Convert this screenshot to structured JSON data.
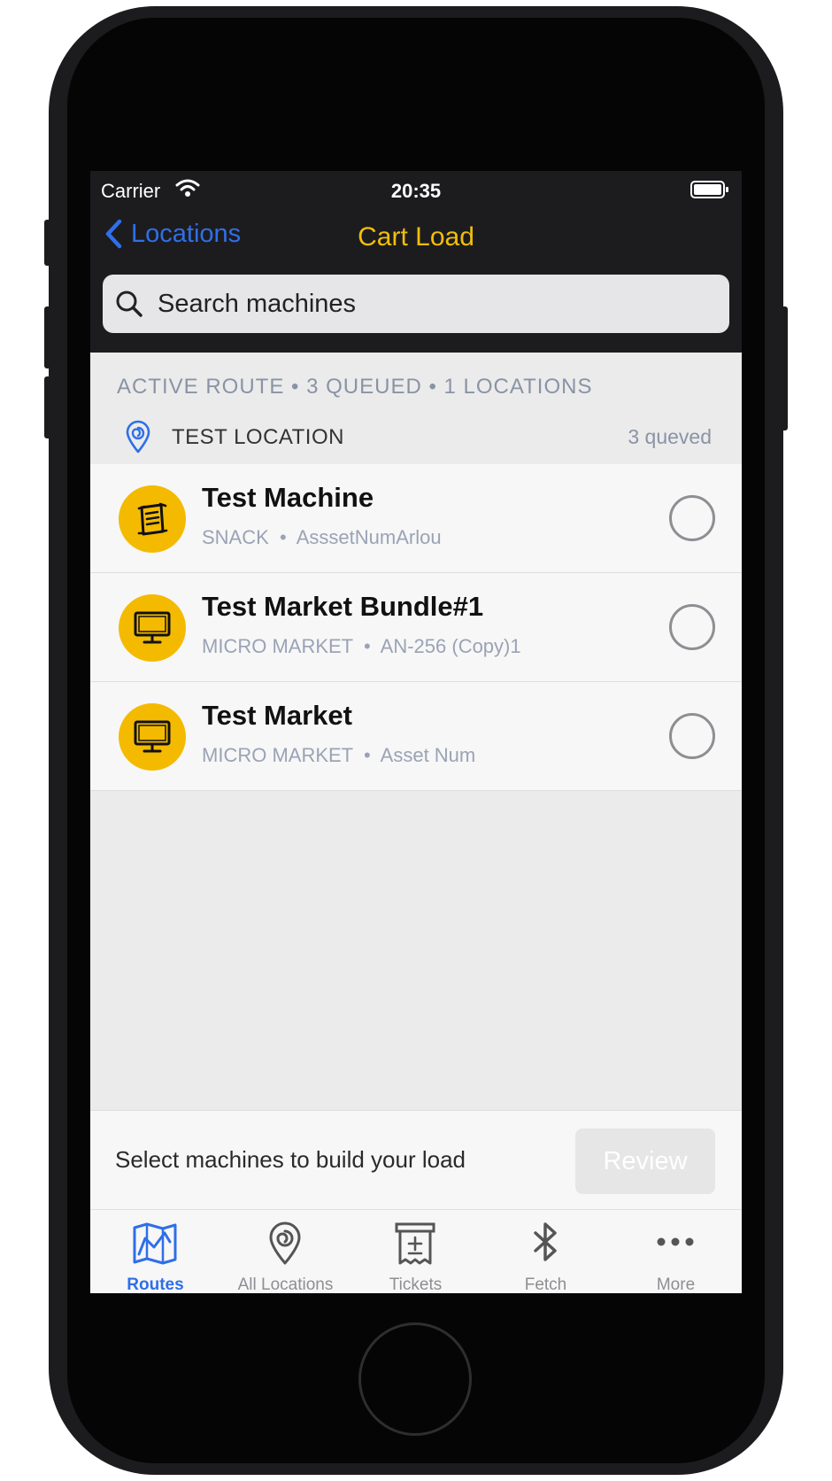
{
  "status_bar": {
    "carrier": "Carrier",
    "time": "20:35"
  },
  "nav": {
    "back_label": "Locations",
    "title": "Cart Load"
  },
  "search": {
    "placeholder": "Search machines"
  },
  "route": {
    "header": "ACTIVE ROUTE  •  3 QUEUED  •  1 LOCATIONS"
  },
  "location": {
    "name": "TEST LOCATION",
    "count": "3 queved"
  },
  "machines": [
    {
      "name": "Test Machine",
      "type": "SNACK",
      "asset": "AsssetNumArlou",
      "icon": "snack-icon"
    },
    {
      "name": "Test Market Bundle#1",
      "type": "MICRO MARKET",
      "asset": "AN-256 (Copy)1",
      "icon": "monitor-icon"
    },
    {
      "name": "Test Market",
      "type": "MICRO MARKET",
      "asset": "Asset Num",
      "icon": "monitor-icon"
    }
  ],
  "footer": {
    "hint": "Select machines to build your load",
    "review_label": "Review"
  },
  "tabs": [
    {
      "label": "Routes",
      "icon": "map-icon",
      "active": true
    },
    {
      "label": "All Locations",
      "icon": "location-pin-icon",
      "active": false
    },
    {
      "label": "Tickets",
      "icon": "ticket-icon",
      "active": false
    },
    {
      "label": "Fetch",
      "icon": "bluetooth-icon",
      "active": false
    },
    {
      "label": "More",
      "icon": "more-icon",
      "active": false
    }
  ],
  "colors": {
    "accent": "#2f6fe8",
    "title": "#f2be0a",
    "avatar": "#f4ba00",
    "bar": "#1c1c1e"
  }
}
